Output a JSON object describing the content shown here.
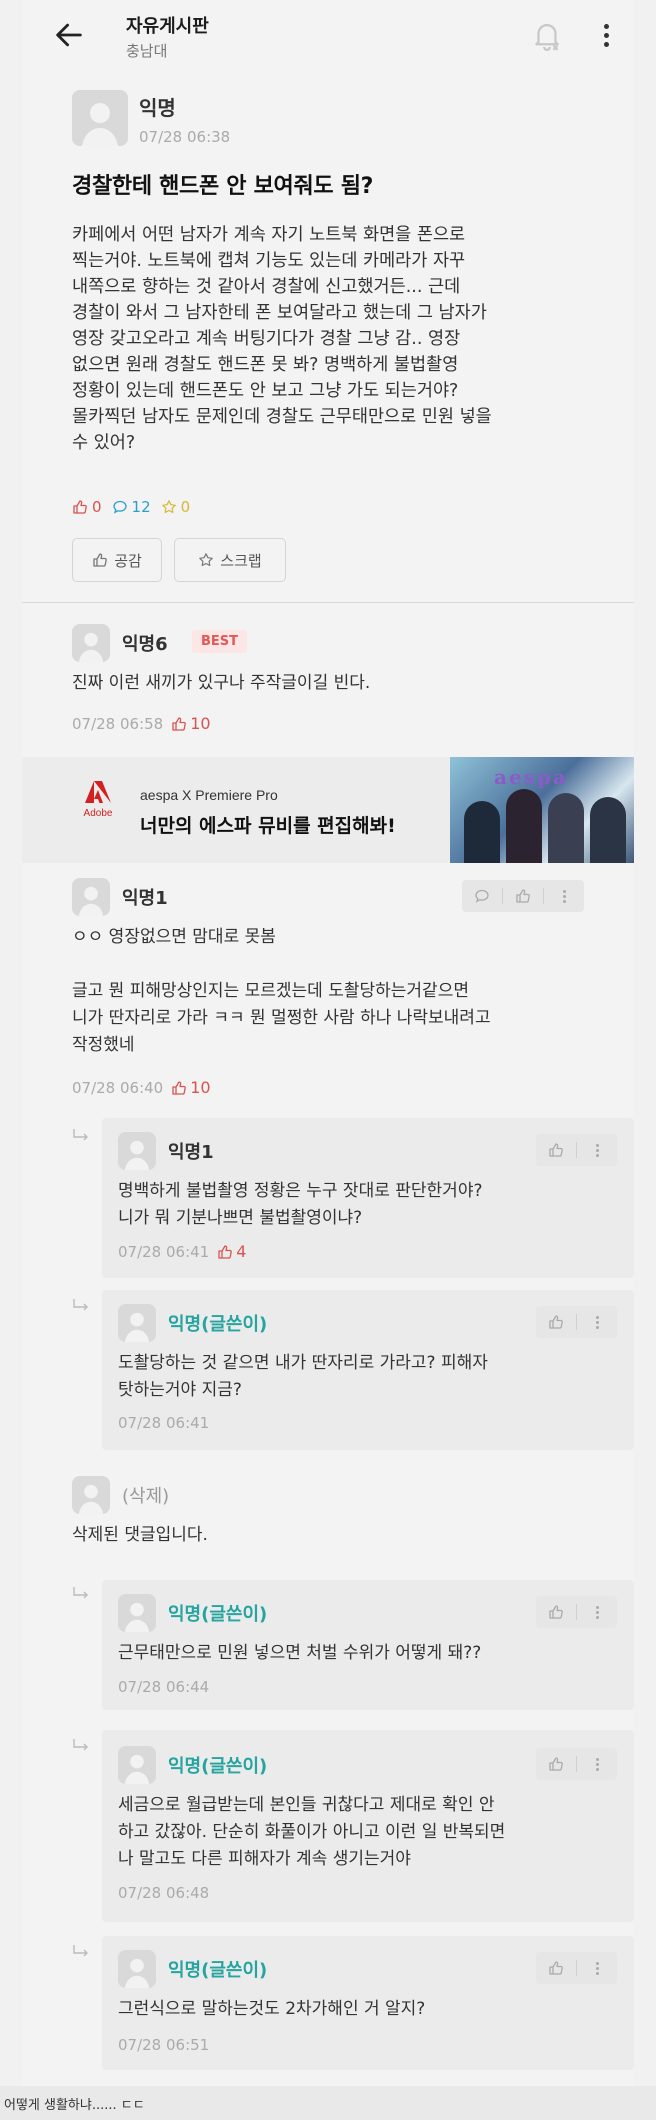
{
  "header": {
    "board_title": "자유게시판",
    "board_subtitle": "충남대",
    "back_icon": "arrow-left-icon",
    "notify_icon": "bell-off-icon",
    "more_icon": "more-vertical-icon"
  },
  "post": {
    "author": "익명",
    "time": "07/28 06:38",
    "title": "경찰한테 핸드폰 안 보여줘도 됨?",
    "body": "카페에서 어떤 남자가 계속 자기 노트북 화면을 폰으로\n찍는거야. 노트북에 캡쳐 기능도 있는데 카메라가 자꾸\n내쪽으로 향하는 것 같아서 경찰에 신고했거든... 근데\n경찰이 와서 그 남자한테 폰 보여달라고 했는데 그 남자가\n영장 갖고오라고 계속 버팅기다가 경찰 그냥 감.. 영장\n없으면 원래 경찰도 핸드폰 못 봐? 명백하게 불법촬영\n정황이 있는데 핸드폰도 안 보고 그냥 가도 되는거야?\n몰카찍던 남자도 문제인데 경찰도 근무태만으로 민원 넣을\n수 있어?",
    "likes": "0",
    "comments": "12",
    "scraps": "0",
    "like_button": "공감",
    "scrap_button": "스크랩"
  },
  "best_comment": {
    "author": "익명6",
    "badge": "BEST",
    "body": "진짜 이런 새끼가 있구나 주작글이길 빈다.",
    "time": "07/28 06:58",
    "likes": "10"
  },
  "ad": {
    "brand_word": "Adobe",
    "line1": "aespa X Premiere Pro",
    "line2": "너만의 에스파 뮤비를 편집해봐!",
    "image_text": "aespa"
  },
  "comments": [
    {
      "author": "익명1",
      "body": "ㅇㅇ 영장없으면 맘대로 못봄\n\n글고 뭔 피해망상인지는 모르겠는데 도촬당하는거같으면\n니가 딴자리로 가라 ㅋㅋ 뭔 멀쩡한 사람 하나 나락보내려고\n작정했네",
      "time": "07/28 06:40",
      "likes": "10"
    },
    {
      "author": "익명1",
      "body": "명백하게 불법촬영 정황은 누구 잣대로 판단한거야?\n니가 뭐 기분나쁘면 불법촬영이냐?",
      "time": "07/28 06:41",
      "likes": "4"
    },
    {
      "author": "익명(글쓴이)",
      "body": "도촬당하는 것 같으면 내가 딴자리로 가라고? 피해자\n탓하는거야 지금?",
      "time": "07/28 06:41",
      "likes": ""
    },
    {
      "author": "(삭제)",
      "body": "삭제된 댓글입니다.",
      "time": "",
      "likes": ""
    },
    {
      "author": "익명(글쓴이)",
      "body": "근무태만으로 민원 넣으면 처벌 수위가 어떻게 돼??",
      "time": "07/28 06:44",
      "likes": ""
    },
    {
      "author": "익명(글쓴이)",
      "body": "세금으로 월급받는데 본인들 귀찮다고 제대로 확인 안\n하고 갔잖아. 단순히 화풀이가 아니고 이런 일 반복되면\n나 말고도 다른 피해자가 계속 생기는거야",
      "time": "07/28 06:48",
      "likes": ""
    },
    {
      "author": "익명(글쓴이)",
      "body": "그런식으로 말하는것도 2차가해인 거 알지?",
      "time": "07/28 06:51",
      "likes": ""
    }
  ],
  "caption": "어떻게 생활하냐...... ㄷㄷ",
  "colors": {
    "like": "#d9534f",
    "comment": "#2aa0c8",
    "scrap": "#d8b830",
    "writer": "#25a4a0",
    "best_badge": "#e25757"
  }
}
